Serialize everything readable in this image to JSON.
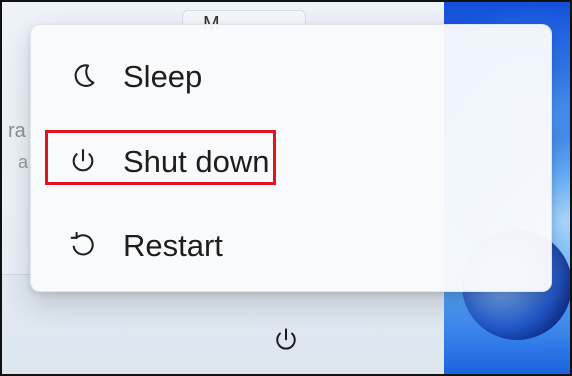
{
  "background": {
    "top_button_text": "M",
    "left_partial_text_1": "ra",
    "left_partial_text_2": "a"
  },
  "power_menu": {
    "items": [
      {
        "label": "Sleep",
        "icon": "moon-icon"
      },
      {
        "label": "Shut down",
        "icon": "power-icon"
      },
      {
        "label": "Restart",
        "icon": "restart-icon"
      }
    ],
    "highlighted_item": "Shut down"
  },
  "footer": {
    "power_icon": "power-icon"
  },
  "colors": {
    "highlight": "#e0141e",
    "menu_background": "#f9fafc",
    "wallpaper_primary": "#1f6ef3"
  }
}
